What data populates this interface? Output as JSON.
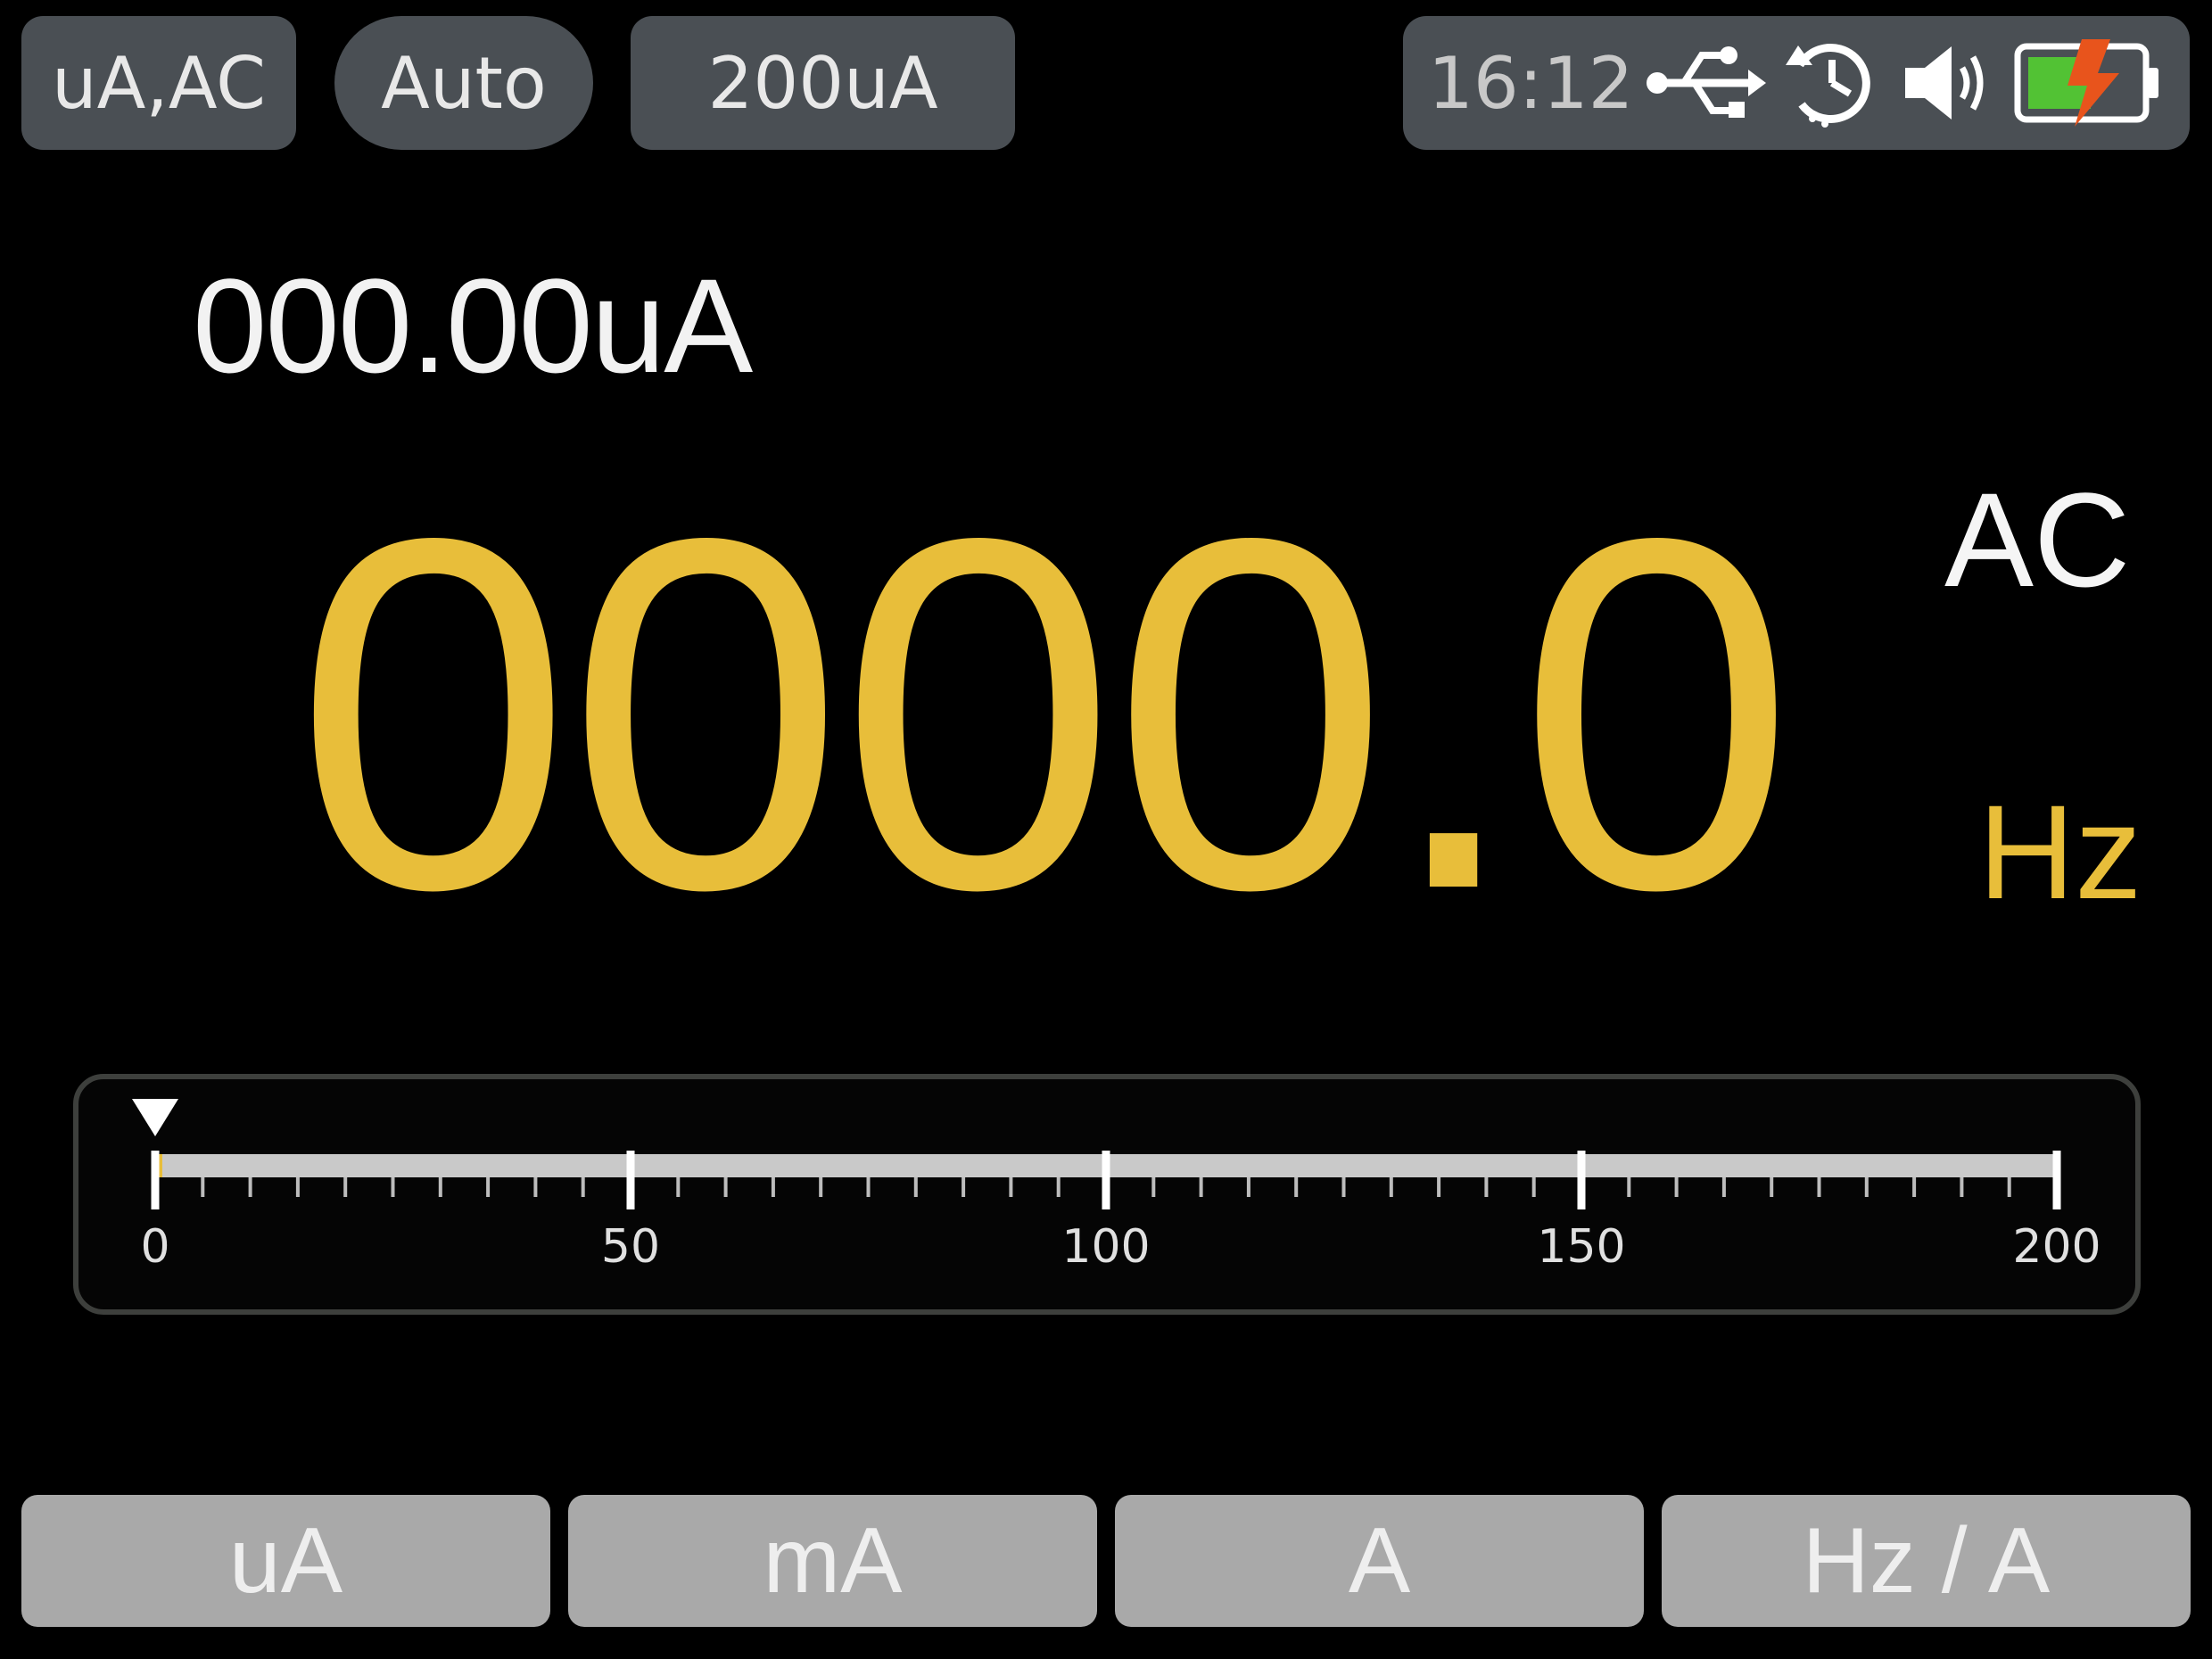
{
  "header": {
    "mode": "uA,AC",
    "range_mode": "Auto",
    "range": "200uA"
  },
  "status": {
    "time": "16:12",
    "icons": [
      "usb-icon",
      "auto-power-off-timer-icon",
      "speaker-volume-icon",
      "battery-charging-icon"
    ],
    "battery_color": "#52c234",
    "charging_bolt_color": "#e8541c"
  },
  "readings": {
    "secondary": "000.00uA",
    "primary": "0000.0",
    "coupling": "AC",
    "primary_unit": "Hz"
  },
  "bargraph": {
    "min": 0,
    "max": 200,
    "tick_labels": [
      "0",
      "50",
      "100",
      "150",
      "200"
    ],
    "value": 0
  },
  "function_keys": [
    {
      "label": "uA"
    },
    {
      "label": "mA"
    },
    {
      "label": "A"
    },
    {
      "label": "Hz / A"
    }
  ],
  "colors": {
    "primary_reading": "#e8be3a",
    "pill_background": "#4a4f54",
    "function_key_background": "#a9a9a9"
  }
}
